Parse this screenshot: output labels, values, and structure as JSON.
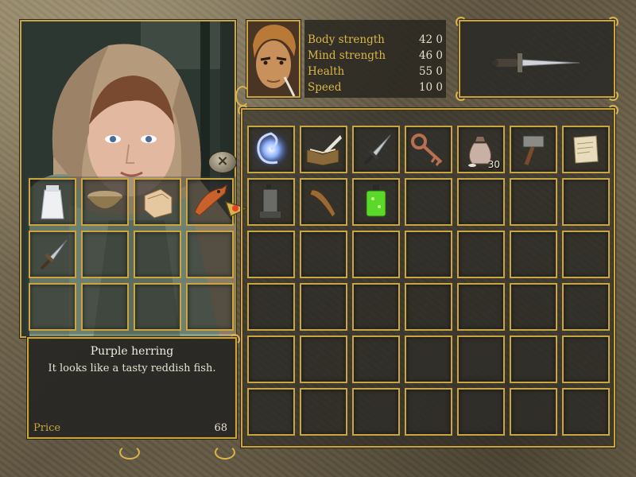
{
  "merchant": {
    "name": "merchant-portrait",
    "close_symbol": "×"
  },
  "merchant_items": [
    {
      "icon": "flour-sack-icon",
      "row": 0,
      "col": 0
    },
    {
      "icon": "bowl-icon",
      "row": 0,
      "col": 1
    },
    {
      "icon": "bread-loaf-icon",
      "row": 0,
      "col": 2
    },
    {
      "icon": "herring-fish-icon",
      "row": 0,
      "col": 3
    },
    {
      "icon": "dagger-icon",
      "row": 1,
      "col": 0
    }
  ],
  "description": {
    "title": "Purple herring",
    "text": "It looks like a tasty reddish fish.",
    "price_label": "Price",
    "price_value": "68"
  },
  "player_stats": [
    {
      "label": "Body strength",
      "value": "42 0"
    },
    {
      "label": "Mind strength",
      "value": "46 0"
    },
    {
      "label": "Health",
      "value": "55 0"
    },
    {
      "label": "Speed",
      "value": "10 0"
    }
  ],
  "equipped": {
    "icon": "dagger-icon"
  },
  "inventory_items": [
    {
      "icon": "swirl-portal-icon",
      "row": 0,
      "col": 0,
      "qty": ""
    },
    {
      "icon": "book-quill-icon",
      "row": 0,
      "col": 1,
      "qty": ""
    },
    {
      "icon": "dagger-icon",
      "row": 0,
      "col": 2,
      "qty": ""
    },
    {
      "icon": "key-icon",
      "row": 0,
      "col": 3,
      "qty": ""
    },
    {
      "icon": "pouch-icon",
      "row": 0,
      "col": 4,
      "qty": "30"
    },
    {
      "icon": "hammer-icon",
      "row": 0,
      "col": 5,
      "qty": ""
    },
    {
      "icon": "scroll-icon",
      "row": 0,
      "col": 6,
      "qty": ""
    },
    {
      "icon": "lantern-icon",
      "row": 1,
      "col": 0,
      "qty": ""
    },
    {
      "icon": "wooden-club-icon",
      "row": 1,
      "col": 1,
      "qty": ""
    },
    {
      "icon": "green-potion-icon",
      "row": 1,
      "col": 2,
      "qty": ""
    }
  ],
  "colors": {
    "frame_gold": "#c9a640",
    "stat_label": "#d9b64a",
    "text_light": "#f1ecde"
  }
}
